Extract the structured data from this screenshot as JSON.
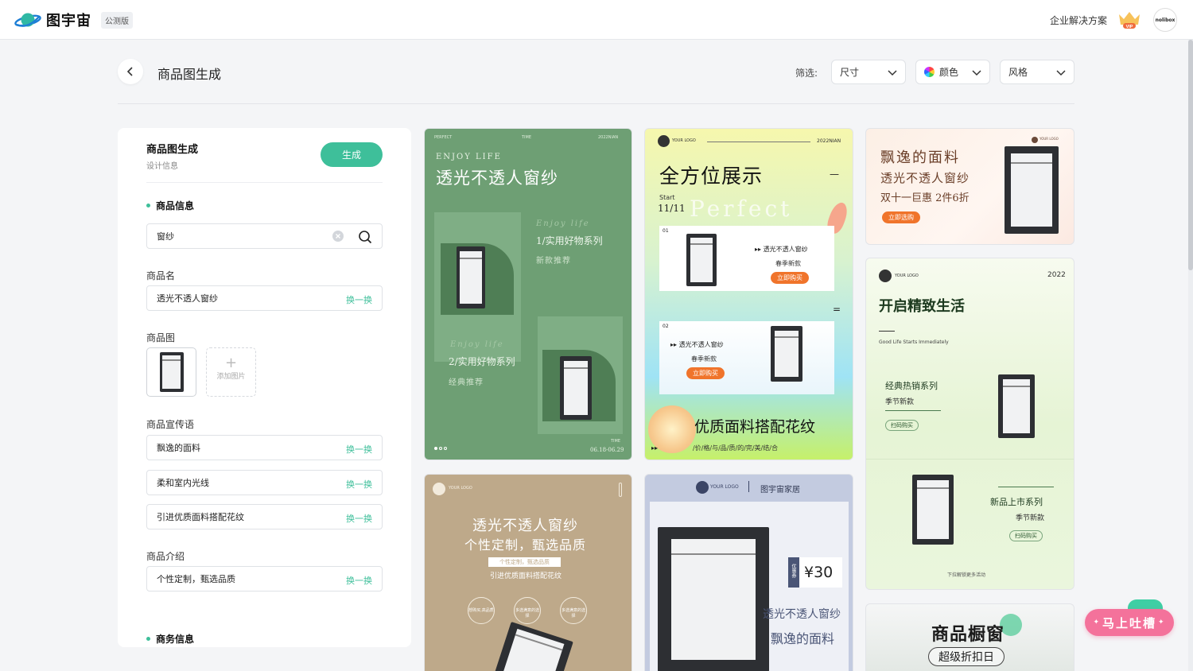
{
  "app": {
    "name": "图宇宙",
    "beta_badge": "公测版",
    "enterprise_link": "企业解决方案",
    "vip_badge": "VIP",
    "user_avatar_text": "nolibox"
  },
  "page": {
    "title": "商品图生成",
    "filter_label": "筛选:"
  },
  "filters": {
    "size": "尺寸",
    "color": "颜色",
    "style": "风格"
  },
  "panel": {
    "title": "商品图生成",
    "subtitle": "设计信息",
    "generate_label": "生成",
    "section_product": "商品信息",
    "search_value": "窗纱",
    "name_label": "商品名",
    "name_value": "透光不透人窗纱",
    "swap_label": "换一换",
    "image_label": "商品图",
    "add_image_label": "添加图片",
    "slogan_label": "商品宣传语",
    "slogans": [
      "飘逸的面料",
      "柔和室内光线",
      "引进优质面料搭配花纹"
    ],
    "intro_label": "商品介绍",
    "intro_value": "个性定制，甄选品质",
    "section_business": "商务信息"
  },
  "cards": {
    "c1": {
      "top_left": "PERFECT",
      "top_mid": "TIME",
      "top_right": "2022NIAN",
      "eyebrow": "ENJOY LIFE",
      "title": "透光不透人窗纱",
      "script1": "Enjoy life",
      "series1": "1/实用好物系列",
      "sub1": "新款推荐",
      "script2": "Enjoy life",
      "series2": "2/实用好物系列",
      "sub2": "经典推荐",
      "time_label": "TIME",
      "date": "06.18-06.29"
    },
    "c2": {
      "logo": "YOUR LOGO",
      "year": "2022NIAN",
      "title": "全方位展示",
      "start": "Start",
      "date": "11/11",
      "bg_word": "Perfect",
      "n1": "01",
      "p1_name": "透光不透人窗纱",
      "p1_sub": "春季新款",
      "p1_btn": "立即购买",
      "n2": "02",
      "p2_name": "透光不透人窗纱",
      "p2_sub": "春季新款",
      "p2_btn": "立即购买",
      "banner": "优质面料搭配花纹",
      "footer": "/价/格/与/品/质/的/完/美/结/合"
    },
    "c3": {
      "logo": "YOUR LOGO",
      "line1": "飘逸的面料",
      "line2": "透光不透人窗纱",
      "line3": "双十一巨惠 2件6折",
      "btn": "立即选购"
    },
    "c4": {
      "logo": "YOUR LOGO",
      "year": "2022",
      "title": "开启精致生活",
      "eng": "Good Life Starts Immediately",
      "s1_title": "经典热销系列",
      "s1_sub": "季节新款",
      "s1_btn": "扫码购买",
      "s2_title": "新品上市系列",
      "s2_sub": "季节新款",
      "s2_btn": "扫码购买",
      "more": "下拉解锁更多活动"
    },
    "c5": {
      "logo": "YOUR LOGO",
      "title1": "透光不透人窗纱",
      "title2": "个性定制，甄选品质",
      "tag": "个性定制，甄选品质",
      "sub": "引进优质面料搭配花纹",
      "b1": "想购买,高品质",
      "b2": "多选满意的选择",
      "b3": "多选满意的选择"
    },
    "c6": {
      "logo": "YOUR LOGO",
      "brand": "图宇宙家居",
      "coupon_label": "优惠券",
      "price": "¥30",
      "line1": "透光不透人窗纱",
      "line2": "飘逸的面料"
    },
    "c7": {
      "title": "商品橱窗",
      "sub": "超级折扣日"
    }
  },
  "feedback": {
    "label": "马上吐槽"
  },
  "colors": {
    "accent": "#3ebf9a",
    "card1": "#6e9f74",
    "orange": "#f0742b",
    "fab": "#f4729b"
  }
}
